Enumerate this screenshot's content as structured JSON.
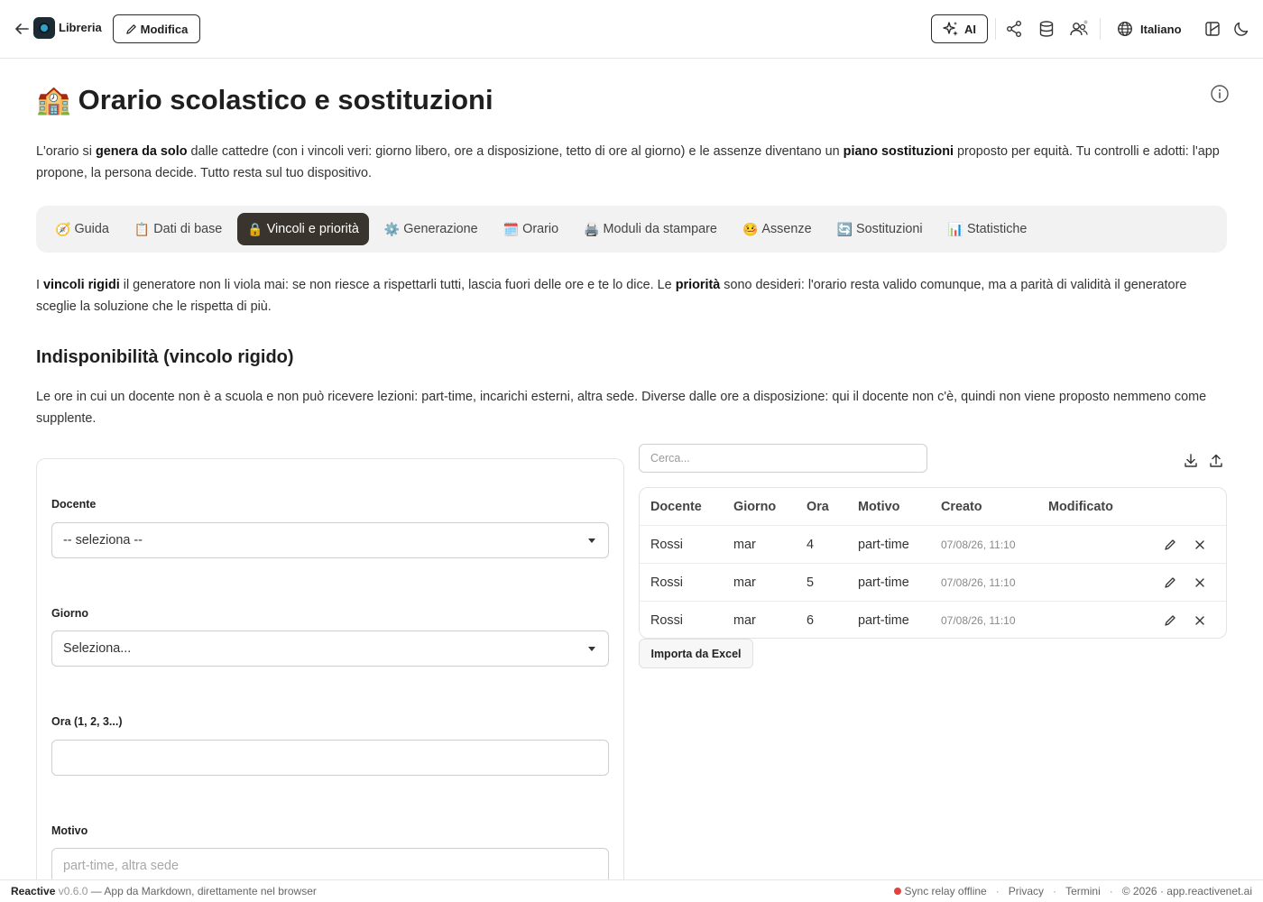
{
  "topbar": {
    "app_name": "Libreria",
    "edit_label": "Modifica",
    "ai_label": "AI",
    "language": "Italiano"
  },
  "page": {
    "title_emoji": "🏫",
    "title": "Orario scolastico e sostituzioni",
    "intro": {
      "t1": "L'orario si ",
      "b1": "genera da solo",
      "t2": " dalle cattedre (con i vincoli veri: giorno libero, ore a disposizione, tetto di ore al giorno) e le assenze diventano un ",
      "b2": "piano sostituzioni",
      "t3": " proposto per equità. Tu controlli e adotti: l'app propone, la persona decide. Tutto resta sul tuo dispositivo."
    }
  },
  "tabs": [
    {
      "emoji": "🧭",
      "label": "Guida"
    },
    {
      "emoji": "📋",
      "label": "Dati di base"
    },
    {
      "emoji": "🔒",
      "label": "Vincoli e priorità",
      "active": true
    },
    {
      "emoji": "⚙️",
      "label": "Generazione"
    },
    {
      "emoji": "🗓️",
      "label": "Orario"
    },
    {
      "emoji": "🖨️",
      "label": "Moduli da stampare"
    },
    {
      "emoji": "🤒",
      "label": "Assenze"
    },
    {
      "emoji": "🔄",
      "label": "Sostituzioni"
    },
    {
      "emoji": "📊",
      "label": "Statistiche"
    }
  ],
  "rules": {
    "t1": "I ",
    "b1": "vincoli rigidi",
    "t2": " il generatore non li viola mai: se non riesce a rispettarli tutti, lascia fuori delle ore e te lo dice. Le ",
    "b2": "priorità",
    "t3": " sono desideri: l'orario resta valido comunque, ma a parità di validità il generatore sceglie la soluzione che le rispetta di più."
  },
  "section": {
    "title": "Indisponibilità (vincolo rigido)",
    "desc": "Le ore in cui un docente non è a scuola e non può ricevere lezioni: part-time, incarichi esterni, altra sede. Diverse dalle ore a disposizione: qui il docente non c'è, quindi non viene proposto nemmeno come supplente."
  },
  "form": {
    "docente_label": "Docente",
    "docente_value": "-- seleziona --",
    "giorno_label": "Giorno",
    "giorno_value": "Seleziona...",
    "ora_label": "Ora (1, 2, 3...)",
    "ora_value": "",
    "motivo_label": "Motivo",
    "motivo_placeholder": "part-time, altra sede"
  },
  "table": {
    "search_placeholder": "Cerca...",
    "columns": [
      "Docente",
      "Giorno",
      "Ora",
      "Motivo",
      "Creato",
      "Modificato"
    ],
    "rows": [
      {
        "docente": "Rossi",
        "giorno": "mar",
        "ora": "4",
        "motivo": "part-time",
        "creato": "07/08/26, 11:10",
        "modificato": ""
      },
      {
        "docente": "Rossi",
        "giorno": "mar",
        "ora": "5",
        "motivo": "part-time",
        "creato": "07/08/26, 11:10",
        "modificato": ""
      },
      {
        "docente": "Rossi",
        "giorno": "mar",
        "ora": "6",
        "motivo": "part-time",
        "creato": "07/08/26, 11:10",
        "modificato": ""
      }
    ],
    "import_label": "Importa da Excel"
  },
  "footer": {
    "brand": "Reactive",
    "version": "v0.6.0",
    "tagline": " — App da Markdown, direttamente nel browser",
    "sync_status": "Sync relay offline",
    "privacy": "Privacy",
    "terms": "Termini",
    "copyright": "© 2026 · app.reactivenet.ai"
  },
  "colors": {
    "active_tab_bg": "#3a342e",
    "tabs_bg": "#f2f2f2",
    "offline_dot": "#e0443e",
    "logo_accent": "#2ea3c9"
  }
}
